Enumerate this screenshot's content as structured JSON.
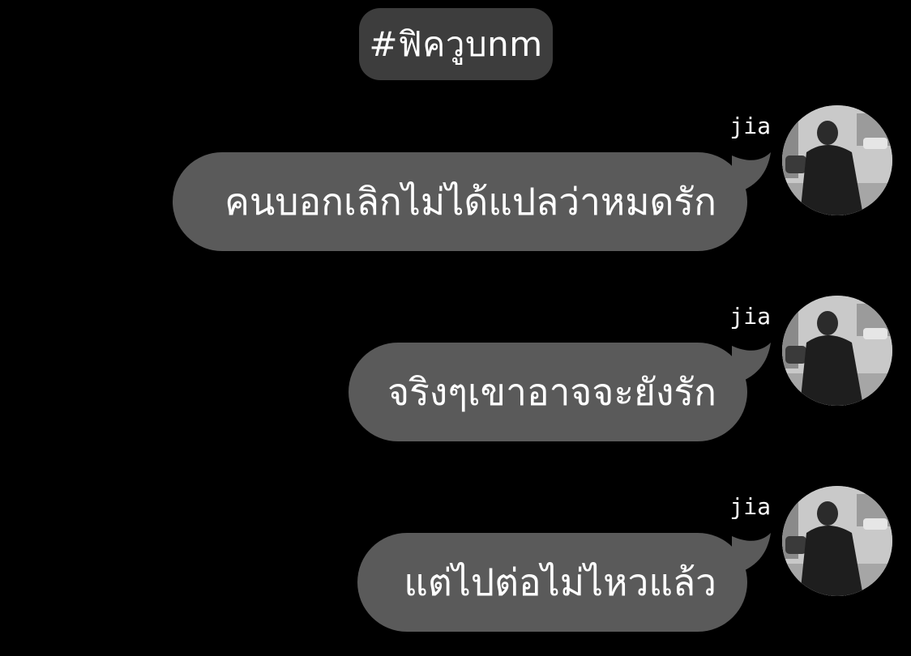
{
  "header": {
    "hashtag": "#ฟิควูบnm"
  },
  "messages": [
    {
      "sender": "jia",
      "text": "คนบอกเลิกไม่ได้แปลว่าหมดรัก"
    },
    {
      "sender": "jia",
      "text": "จริงๆเขาอาจจะยังรัก"
    },
    {
      "sender": "jia",
      "text": "แต่ไปต่อไม่ไหวแล้ว"
    }
  ],
  "colors": {
    "background": "#000000",
    "bubble": "#5a5a5a",
    "hashtag_pill": "#3d3d3d",
    "text": "#ffffff"
  },
  "icons": {
    "avatar": "avatar-photo-icon"
  }
}
